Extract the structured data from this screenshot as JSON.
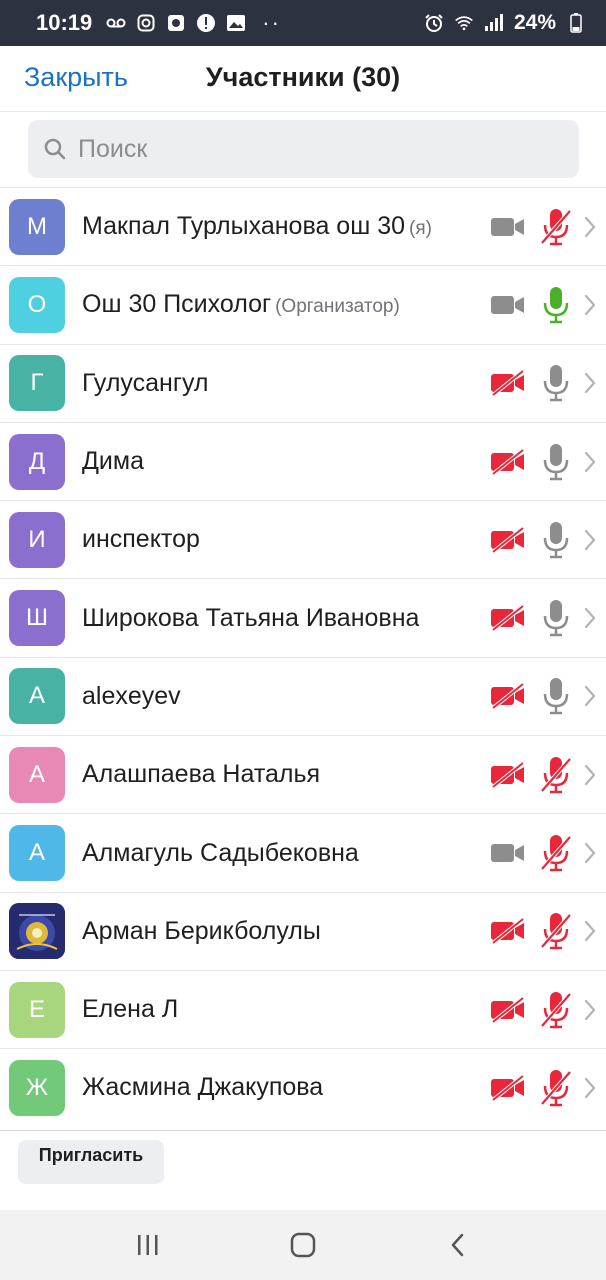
{
  "status_bar": {
    "time": "10:19",
    "battery": "24%",
    "left_icons": [
      "voicemail-icon",
      "instagram-icon",
      "app-icon",
      "alert-icon",
      "gallery-icon"
    ],
    "overflow": "··",
    "right_icons": [
      "alarm-icon",
      "wifi-icon",
      "signal-icon",
      "battery-icon"
    ]
  },
  "header": {
    "close_label": "Закрыть",
    "title": "Участники (30)"
  },
  "search": {
    "placeholder": "Поиск"
  },
  "colors": {
    "accent": "#1a72c8",
    "muted_red": "#e8283a",
    "mic_on_green": "#4caf2a",
    "icon_gray": "#8d8d8d"
  },
  "participants": [
    {
      "initial": "М",
      "name": "Макпал Турлыханова ош 30",
      "tag": "(я)",
      "avatar_color": "#6f7fcf",
      "video": "on",
      "audio": "muted"
    },
    {
      "initial": "О",
      "name": "Ош 30 Психолог",
      "tag": "(Организатор)",
      "avatar_color": "#4fd0e0",
      "video": "on",
      "audio": "active"
    },
    {
      "initial": "Г",
      "name": "Гулусангул",
      "tag": "",
      "avatar_color": "#48b3a5",
      "video": "off",
      "audio": "on"
    },
    {
      "initial": "Д",
      "name": "Дима",
      "tag": "",
      "avatar_color": "#8b6fcf",
      "video": "off",
      "audio": "on"
    },
    {
      "initial": "И",
      "name": "инспектор",
      "tag": "",
      "avatar_color": "#8b6fcf",
      "video": "off",
      "audio": "on"
    },
    {
      "initial": "Ш",
      "name": "Широкова Татьяна Ивановна",
      "tag": "",
      "avatar_color": "#8b6fcf",
      "video": "off",
      "audio": "on"
    },
    {
      "initial": "A",
      "name": "alexeyev",
      "tag": "",
      "avatar_color": "#48b3a5",
      "video": "off",
      "audio": "on"
    },
    {
      "initial": "А",
      "name": "Алашпаева Наталья",
      "tag": "",
      "avatar_color": "#e888b4",
      "video": "off",
      "audio": "muted"
    },
    {
      "initial": "А",
      "name": "Алмагуль Садыбековна",
      "tag": "",
      "avatar_color": "#4fb8e8",
      "video": "on",
      "audio": "muted"
    },
    {
      "initial": "",
      "name": "Арман Берикболулы",
      "tag": "",
      "avatar_color": "#2b2f7a",
      "avatar_image": "emblem-image",
      "video": "off",
      "audio": "muted"
    },
    {
      "initial": "Е",
      "name": "Елена Л",
      "tag": "",
      "avatar_color": "#a8d67e",
      "video": "off",
      "audio": "muted"
    },
    {
      "initial": "Ж",
      "name": "Жасмина Джакупова",
      "tag": "",
      "avatar_color": "#72c97a",
      "video": "off",
      "audio": "muted"
    }
  ],
  "footer": {
    "invite_label": "Пригласить"
  },
  "nav": {
    "items": [
      "recents-icon",
      "home-icon",
      "back-icon"
    ]
  }
}
